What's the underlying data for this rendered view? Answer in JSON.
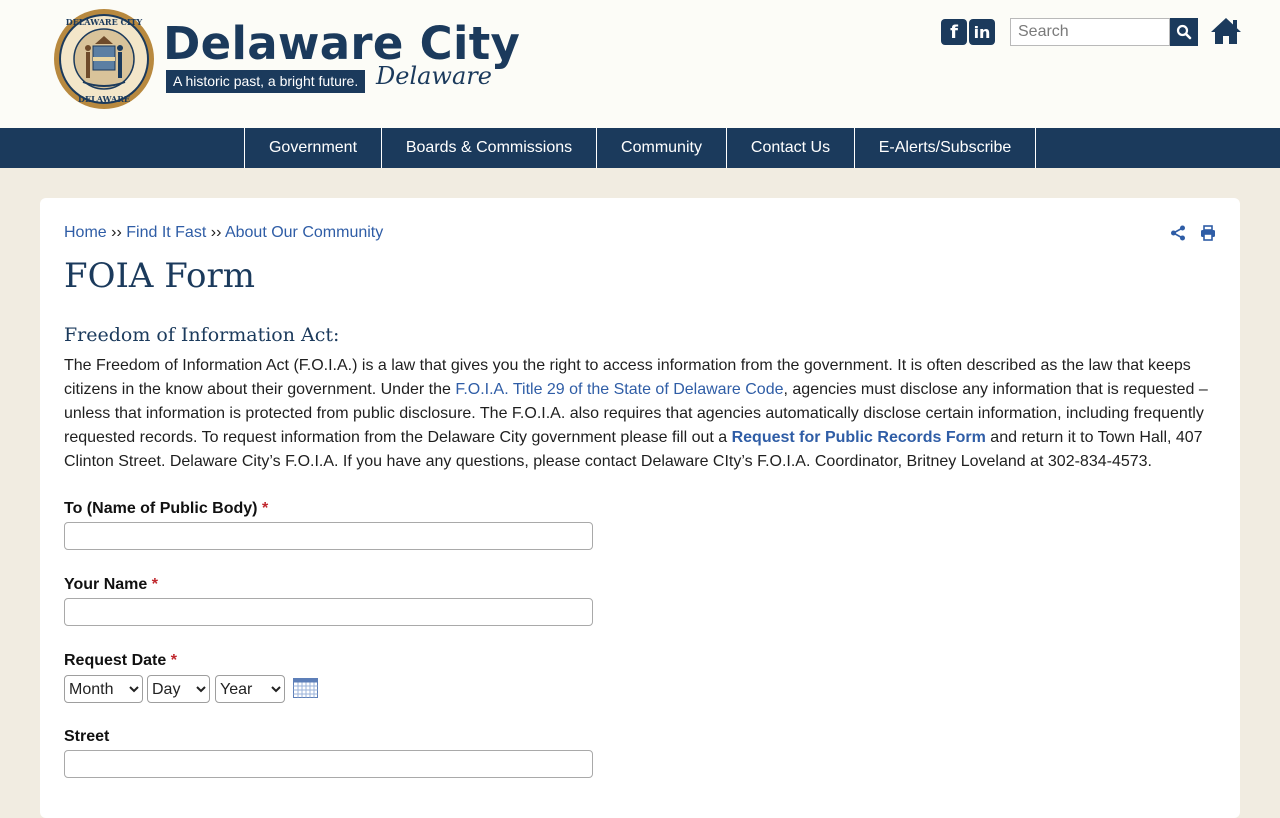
{
  "header": {
    "logo_title": "Delaware City",
    "tagline": "A historic past, a bright future.",
    "script_text": "Delaware",
    "seal_text_top": "DELAWARE CITY",
    "seal_text_bottom": "DELAWARE",
    "social": {
      "facebook_glyph": "f",
      "linkedin_glyph": "in"
    },
    "search": {
      "placeholder": "Search",
      "value": ""
    }
  },
  "nav": {
    "items": [
      {
        "label": "Government"
      },
      {
        "label": "Boards & Commissions"
      },
      {
        "label": "Community"
      },
      {
        "label": "Contact Us"
      },
      {
        "label": "E-Alerts/Subscribe"
      }
    ]
  },
  "breadcrumb": {
    "items": [
      "Home",
      "Find It Fast",
      "About Our Community"
    ],
    "separator": "››"
  },
  "page": {
    "title": "FOIA Form",
    "section_title": "Freedom of Information Act:",
    "intro": {
      "part1": "The Freedom of Information Act (F.O.I.A.)  is a law that gives you the right to access information from the government. It is often described as the law that keeps citizens in the know about their government. Under the ",
      "link1": "F.O.I.A. Title 29 of the State of Delaware Code",
      "part2": ", agencies must disclose any information that is requested – unless that information is protected from public disclosure. The F.O.I.A. also requires that agencies automatically disclose certain information, including frequently requested records. To request information from the Delaware City government please fill out a ",
      "link2": "Request for Public Records Form",
      "part3": " and return it to Town Hall, 407 Clinton Street. Delaware City’s F.O.I.A. If you have any questions, please contact Delaware CIty’s F.O.I.A. Coordinator, Britney Loveland at 302-834-4573."
    }
  },
  "form": {
    "required_marker": "*",
    "to_label": "To (Name of Public Body)",
    "to_value": "",
    "name_label": "Your Name",
    "name_value": "",
    "date_label": "Request Date",
    "month_selected": "Month",
    "day_selected": "Day",
    "year_selected": "Year",
    "street_label": "Street",
    "street_value": ""
  },
  "icons": {
    "search": "search-icon",
    "home": "home-icon",
    "share": "share-icon",
    "print": "print-icon",
    "calendar": "calendar-icon"
  },
  "colors": {
    "brand_navy": "#1b3a5c",
    "link_blue": "#2f5da6",
    "page_bg": "#f1ece1",
    "required_red": "#c0272d"
  }
}
